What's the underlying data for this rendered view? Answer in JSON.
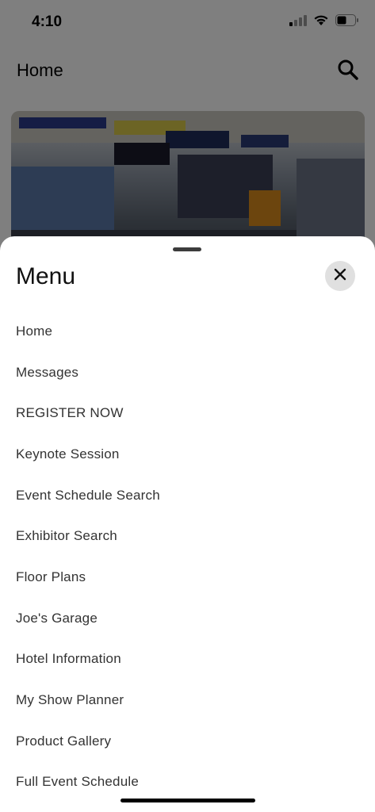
{
  "status_bar": {
    "time": "4:10",
    "icons": [
      "cellular-signal-icon",
      "wifi-icon",
      "battery-icon"
    ]
  },
  "header": {
    "title": "Home",
    "search_icon": "search-icon"
  },
  "hero": {
    "description_icon": "trade-show-photo"
  },
  "menu": {
    "title": "Menu",
    "close_icon": "close-icon",
    "items": [
      "Home",
      "Messages",
      "REGISTER NOW",
      "Keynote Session",
      "Event Schedule Search",
      "Exhibitor Search",
      "Floor Plans",
      "Joe's Garage",
      "Hotel Information",
      "My Show Planner",
      "Product Gallery",
      "Full Event Schedule"
    ]
  },
  "colors": {
    "overlay": "#000000",
    "sheet_bg": "#ffffff",
    "close_bg": "#e0e0e0",
    "item_text": "#333333"
  }
}
